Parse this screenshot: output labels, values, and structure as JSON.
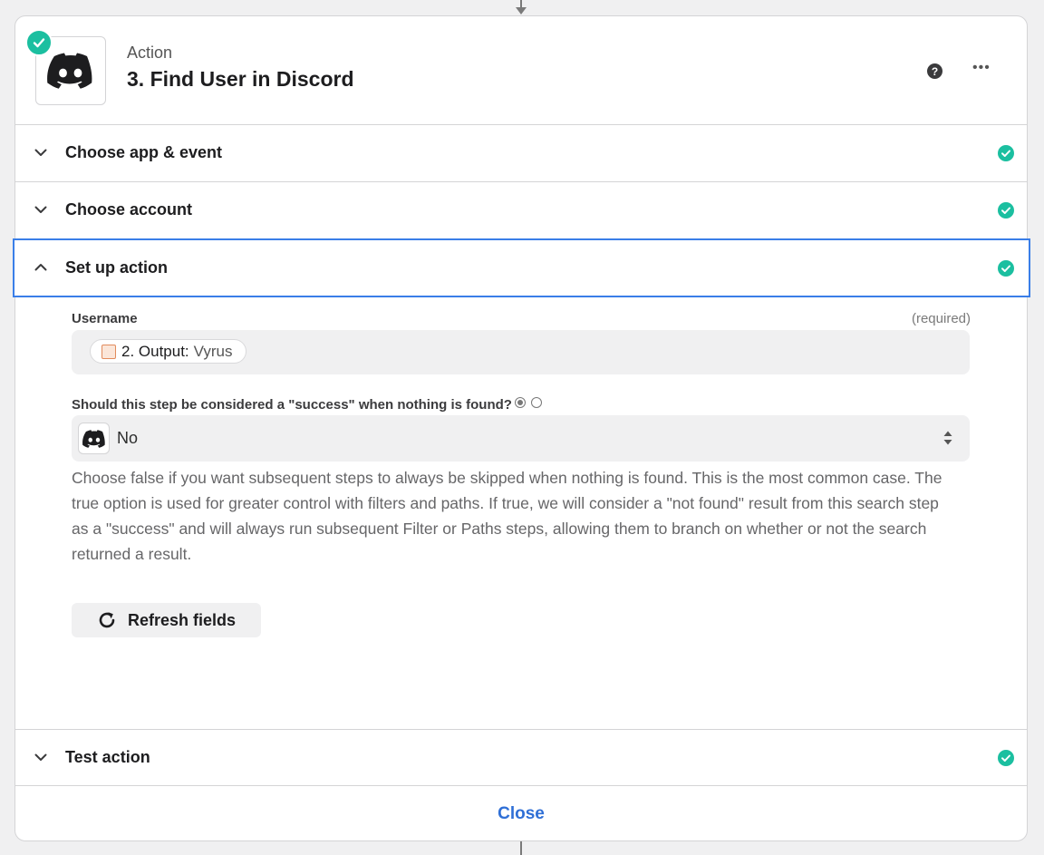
{
  "header": {
    "kicker": "Action",
    "title": "3. Find User in Discord",
    "help_icon": "question-circle-icon",
    "more_icon": "ellipsis-icon",
    "app_icon": "discord-icon",
    "status": "complete"
  },
  "sections": [
    {
      "label": "Choose app & event",
      "expanded": false,
      "complete": true
    },
    {
      "label": "Choose account",
      "expanded": false,
      "complete": true
    },
    {
      "label": "Set up action",
      "expanded": true,
      "complete": true
    },
    {
      "label": "Test action",
      "expanded": false,
      "complete": true
    }
  ],
  "setup": {
    "username_label": "Username",
    "username_required": "(required)",
    "username_pill_step": "2. Output:",
    "username_pill_value": "Vyrus",
    "success_question": "Should this step be considered a \"success\" when nothing is found?",
    "success_value": "No",
    "help_text": "Choose false if you want subsequent steps to always be skipped when nothing is found. This is the most common case. The true option is used for greater control with filters and paths. If true, we will consider a \"not found\" result from this search step as a \"success\" and will always run subsequent Filter or Paths steps, allowing them to branch on whether or not the search returned a result.",
    "refresh_label": "Refresh fields"
  },
  "footer": {
    "close_label": "Close"
  },
  "colors": {
    "accent_green": "#1bbfa0",
    "active_border": "#3a7ee8",
    "link_blue": "#2f6fd6"
  }
}
